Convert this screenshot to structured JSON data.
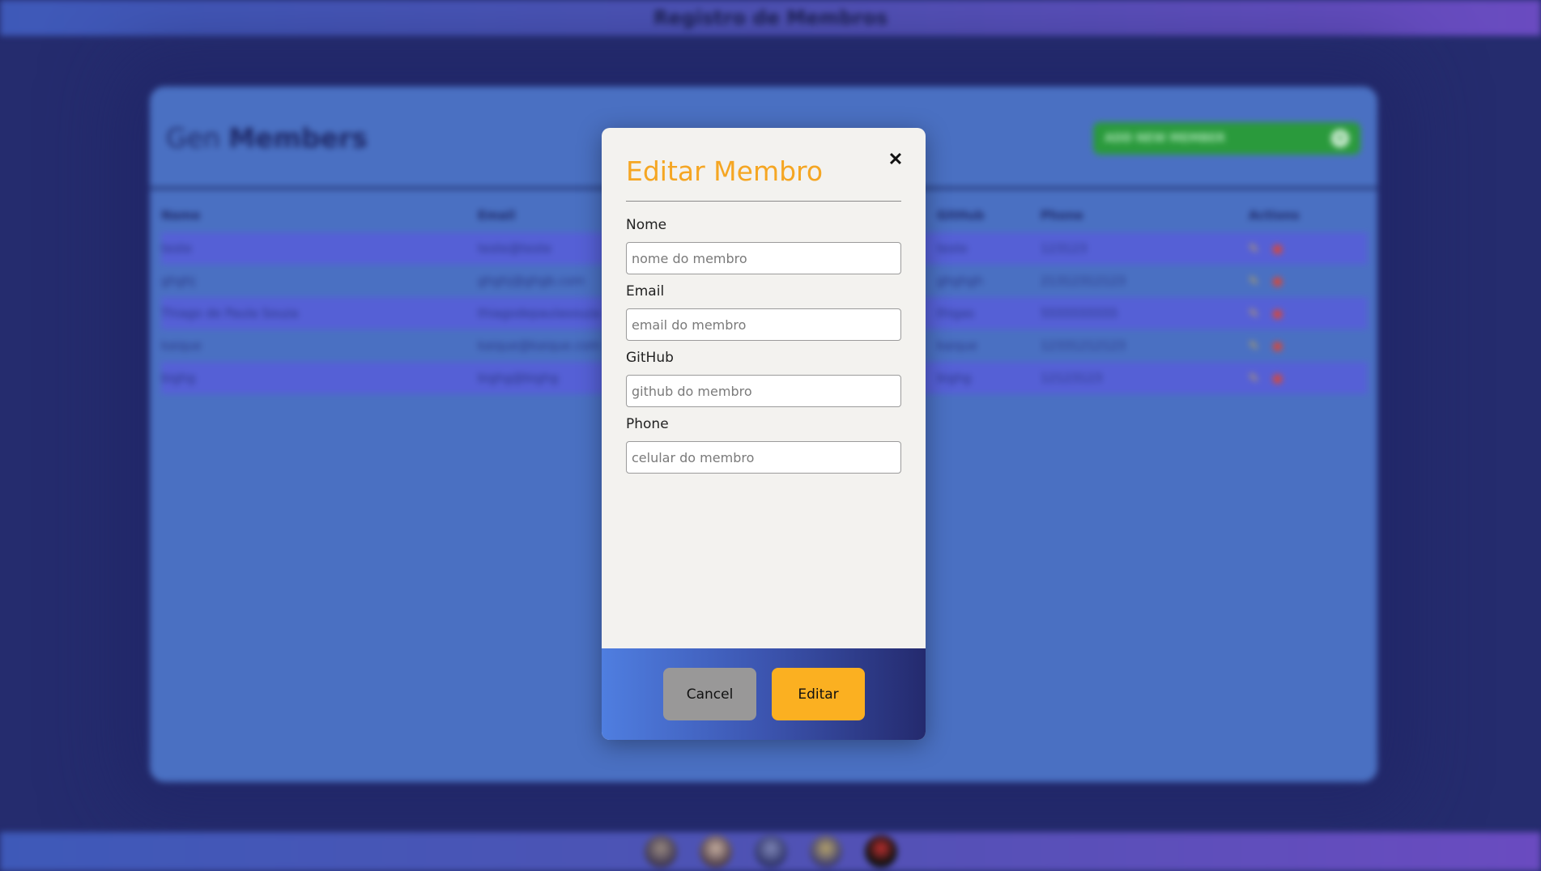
{
  "app": {
    "title": "Registro de Membros"
  },
  "panel": {
    "title_prefix": "Gen",
    "title_bold": "Members",
    "add_button_label": "ADD NEW MEMBER",
    "add_button_icon": "plus-circle-icon"
  },
  "table": {
    "columns": [
      "Name",
      "Email",
      "GitHub",
      "Phone",
      "Actions"
    ],
    "rows": [
      {
        "name": "teste",
        "email": "teste@teste",
        "github": "teste",
        "phone": "123123"
      },
      {
        "name": "ghghj",
        "email": "ghghj@ghgb.com",
        "github": "ghghgh",
        "phone": "21312312123"
      },
      {
        "name": "Thiago de Paula Souza",
        "email": "thiagodepaulasouza",
        "github": "thigas",
        "phone": "5555555555"
      },
      {
        "name": "kaique",
        "email": "kaique@kaique.com",
        "github": "kaique",
        "phone": "12331212123"
      },
      {
        "name": "bighg",
        "email": "bighg@bighg",
        "github": "bighg",
        "phone": "12123123"
      }
    ],
    "action_icons": [
      "pencil-icon",
      "trash-icon"
    ]
  },
  "modal": {
    "title": "Editar Membro",
    "close_icon": "close-icon",
    "fields": [
      {
        "label": "Nome",
        "placeholder": "nome do membro",
        "value": ""
      },
      {
        "label": "Email",
        "placeholder": "email do membro",
        "value": ""
      },
      {
        "label": "GitHub",
        "placeholder": "github do membro",
        "value": ""
      },
      {
        "label": "Phone",
        "placeholder": "celular do membro",
        "value": ""
      }
    ],
    "cancel_label": "Cancel",
    "submit_label": "Editar"
  },
  "colors": {
    "accent": "#f5a623",
    "submit_button": "#fbb021",
    "cancel_button": "#999898",
    "add_button": "#2a9a3c"
  }
}
